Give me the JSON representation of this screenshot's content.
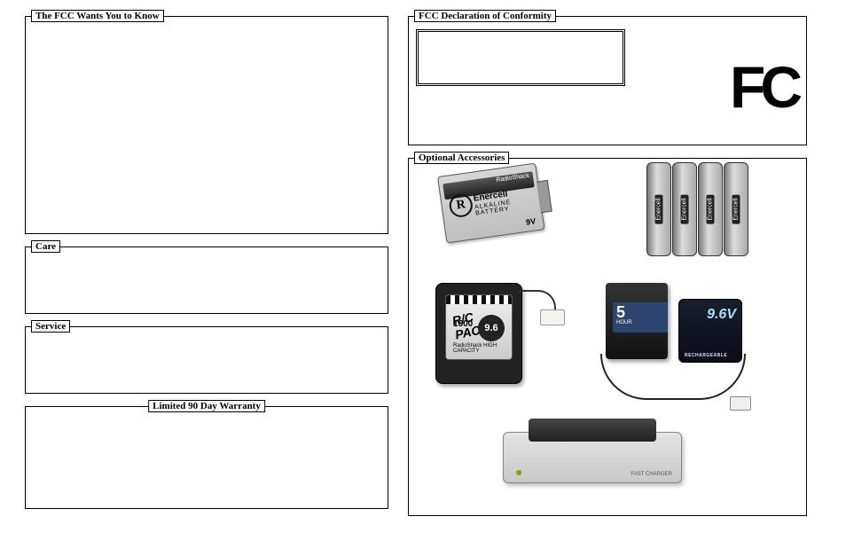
{
  "left": {
    "fcc_know": {
      "title": "The FCC Wants You to Know"
    },
    "care": {
      "title": "Care"
    },
    "service": {
      "title": "Service"
    },
    "warranty": {
      "title": "Limited 90 Day Warranty"
    }
  },
  "right": {
    "fcc_decl": {
      "title": "FCC Declaration of Conformity",
      "logo_text": "FC"
    },
    "accessories": {
      "title": "Optional Accessories",
      "battery_9v": {
        "brand_top": "RadioShack",
        "r_letter": "R",
        "brand": "Enercell",
        "type": "ALKALINE BATTERY",
        "voltage": "9V"
      },
      "aa_cells": {
        "label": "Enercell"
      },
      "rc_pack": {
        "title": "R/C PACK",
        "capacity": "1600",
        "voltage": "9.6",
        "brand": "RadioShack",
        "sub": "HIGH CAPACITY"
      },
      "charger_5hr": {
        "hours": "5",
        "hours_sub": "HOUR",
        "pack_voltage": "9.6V",
        "pack_brand": "RECHARGEABLE"
      },
      "dock": {
        "brand": "FAST CHARGER"
      }
    }
  }
}
